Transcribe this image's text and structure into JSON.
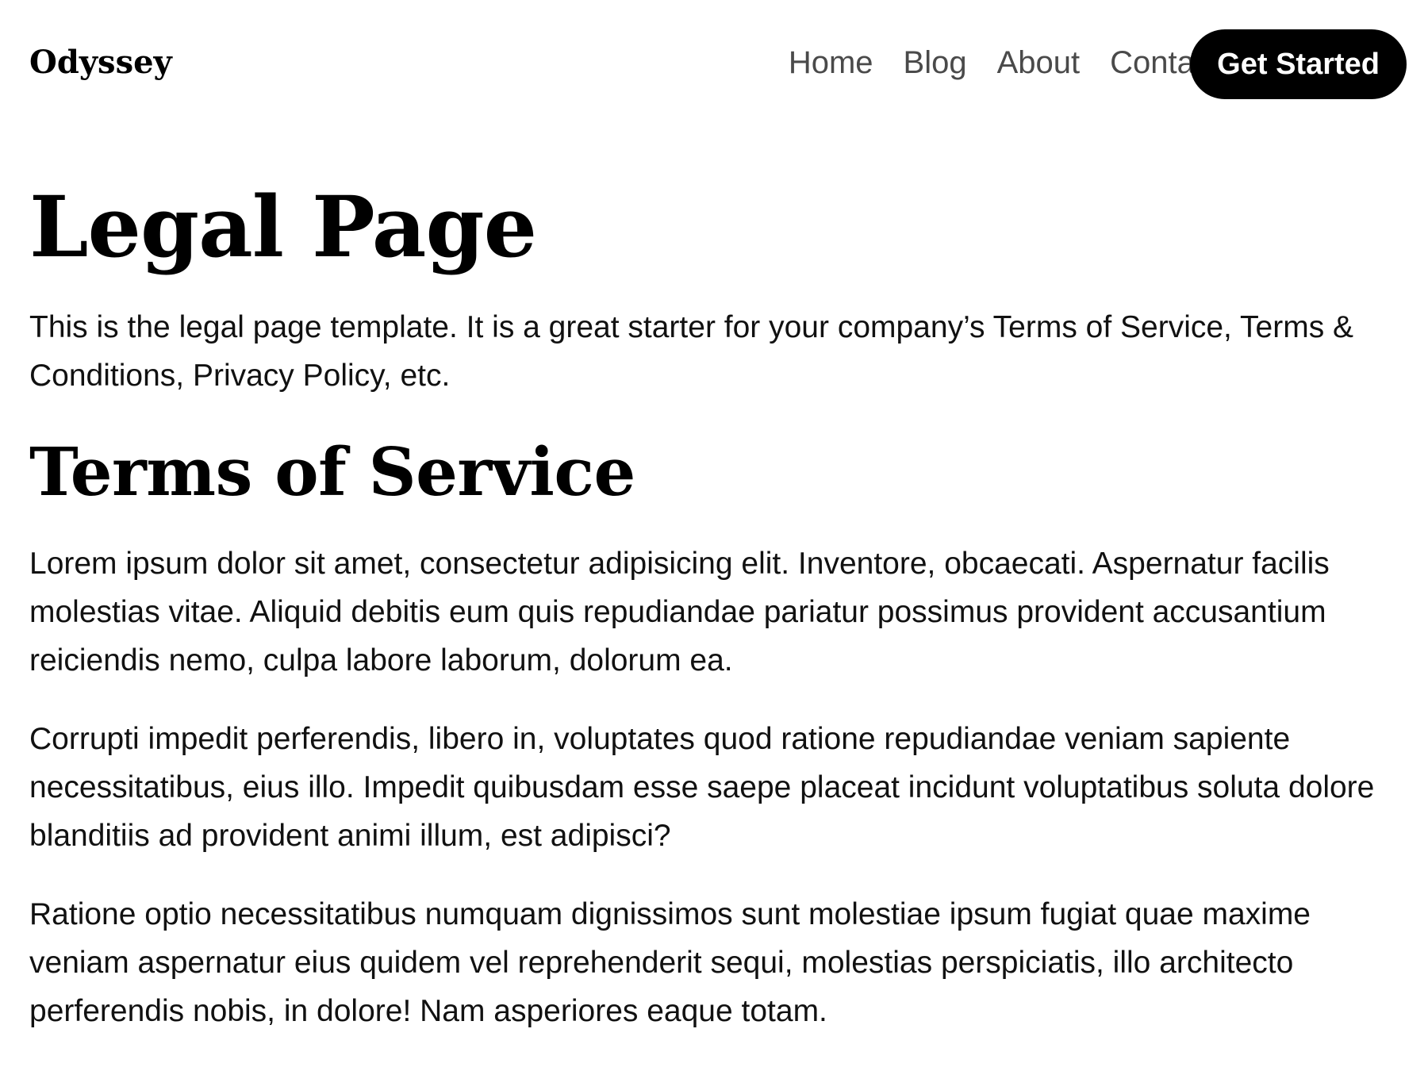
{
  "header": {
    "brand": "Odyssey",
    "nav": [
      {
        "label": "Home"
      },
      {
        "label": "Blog"
      },
      {
        "label": "About"
      },
      {
        "label": "Contact"
      }
    ],
    "cta_label": "Get Started"
  },
  "content": {
    "title": "Legal Page",
    "intro": "This is the legal page template. It is a great starter for your company’s Terms of Service, Terms & Conditions, Privacy Policy, etc.",
    "section_title": "Terms of Service",
    "paragraphs": [
      "Lorem ipsum dolor sit amet, consectetur adipisicing elit. Inventore, obcaecati. Aspernatur facilis molestias vitae. Aliquid debitis eum quis repudiandae pariatur possimus provident accusantium reiciendis nemo, culpa labore laborum, dolorum ea.",
      "Corrupti impedit perferendis, libero in, voluptates quod ratione repudiandae veniam sapiente necessitatibus, eius illo. Impedit quibusdam esse saepe placeat incidunt voluptatibus soluta dolore blanditiis ad provident animi illum, est adipisci?",
      "Ratione optio necessitatibus numquam dignissimos sunt molestiae ipsum fugiat quae maxime veniam aspernatur eius quidem vel reprehenderit sequi, molestias perspiciatis, illo architecto perferendis nobis, in dolore! Nam asperiores eaque totam."
    ]
  },
  "colors": {
    "background": "#ffffff",
    "text": "#111111",
    "nav_text": "#4a4a4a",
    "button_bg": "#000000",
    "button_text": "#ffffff"
  }
}
